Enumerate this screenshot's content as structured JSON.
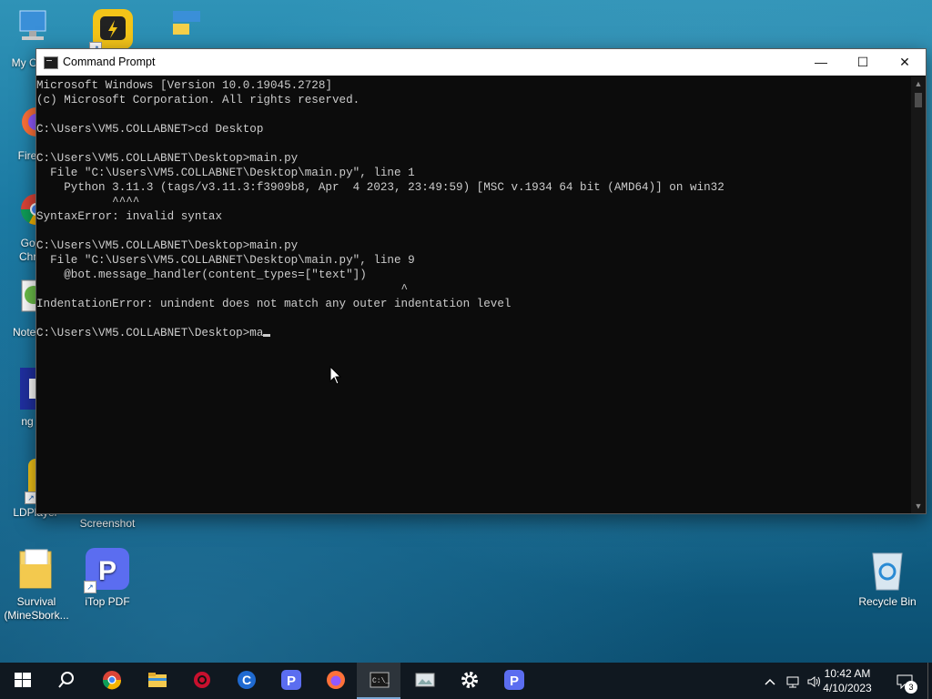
{
  "desktop": {
    "icons": [
      {
        "label": "My Co",
        "kind": "computer"
      },
      {
        "label": "Fire",
        "kind": "firefox"
      },
      {
        "label": "Goo Chro",
        "kind": "chrome"
      },
      {
        "label": "Notep",
        "kind": "notepad"
      },
      {
        "label": "ng",
        "kind": "ngrok"
      },
      {
        "label": "LDPlayer",
        "kind": "ldplayer"
      },
      {
        "label": "Screenshot",
        "kind": "screenshot"
      },
      {
        "label": "Survival (MineSbork...",
        "kind": "folder"
      },
      {
        "label": "iTop PDF",
        "kind": "itop-pdf"
      },
      {
        "label": "Recycle Bin",
        "kind": "recycle-bin"
      }
    ]
  },
  "window": {
    "title": "Command Prompt",
    "buttons": {
      "minimize": "—",
      "maximize": "☐",
      "close": "✕"
    }
  },
  "console": {
    "lines": [
      "Microsoft Windows [Version 10.0.19045.2728]",
      "(c) Microsoft Corporation. All rights reserved.",
      "",
      "C:\\Users\\VM5.COLLABNET>cd Desktop",
      "",
      "C:\\Users\\VM5.COLLABNET\\Desktop>main.py",
      "  File \"C:\\Users\\VM5.COLLABNET\\Desktop\\main.py\", line 1",
      "    Python 3.11.3 (tags/v3.11.3:f3909b8, Apr  4 2023, 23:49:59) [MSC v.1934 64 bit (AMD64)] on win32",
      "           ^^^^",
      "SyntaxError: invalid syntax",
      "",
      "C:\\Users\\VM5.COLLABNET\\Desktop>main.py",
      "  File \"C:\\Users\\VM5.COLLABNET\\Desktop\\main.py\", line 9",
      "    @bot.message_handler(content_types=[\"text\"])",
      "                                                     ^",
      "IndentationError: unindent does not match any outer indentation level",
      "",
      "C:\\Users\\VM5.COLLABNET\\Desktop>ma"
    ]
  },
  "taskbar": {
    "apps": [
      "start",
      "search",
      "chrome",
      "file-explorer",
      "red-app",
      "ccleaner",
      "itop-pdf",
      "firefox",
      "command-prompt",
      "photo-viewer",
      "settings",
      "itop-pdf-2"
    ],
    "clock": {
      "time": "10:42 AM",
      "date": "4/10/2023"
    },
    "notification_count": "3"
  },
  "colors": {
    "console_bg": "#0c0c0c",
    "console_fg": "#cccccc",
    "taskbar": "#101820"
  }
}
